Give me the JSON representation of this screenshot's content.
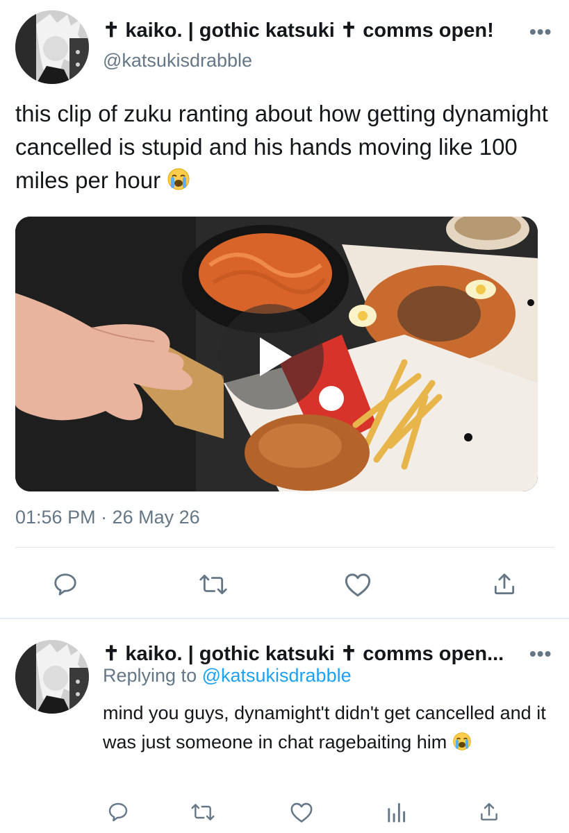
{
  "main_tweet": {
    "display_name": "✝ kaiko. | gothic katsuki ✝ comms open!",
    "handle": "@katsukisdrabble",
    "text": "this clip of zuku ranting about how getting dynamight cancelled is stupid and his hands moving like 100 miles per hour",
    "emoji": "loudly-crying-face",
    "timestamp": "01:56 PM · 26 May 26",
    "media": {
      "type": "video",
      "icon": "play-icon"
    },
    "actions": [
      "reply-icon",
      "retweet-icon",
      "like-icon",
      "share-icon"
    ]
  },
  "reply_tweet": {
    "display_name": "✝ kaiko. | gothic katsuki ✝ comms open...",
    "replying_prefix": "Replying to ",
    "replying_handle": "@katsukisdrabble",
    "text": "mind you guys, dynamight't didn't get cancelled and it was just someone in chat ragebaiting him",
    "emoji": "loudly-crying-face",
    "actions": [
      "reply-icon",
      "retweet-icon",
      "like-icon",
      "analytics-icon",
      "share-icon"
    ]
  },
  "colors": {
    "text": "#14171a",
    "secondary": "#657786",
    "link": "#1da1f2",
    "divider": "#e1e8ed"
  }
}
